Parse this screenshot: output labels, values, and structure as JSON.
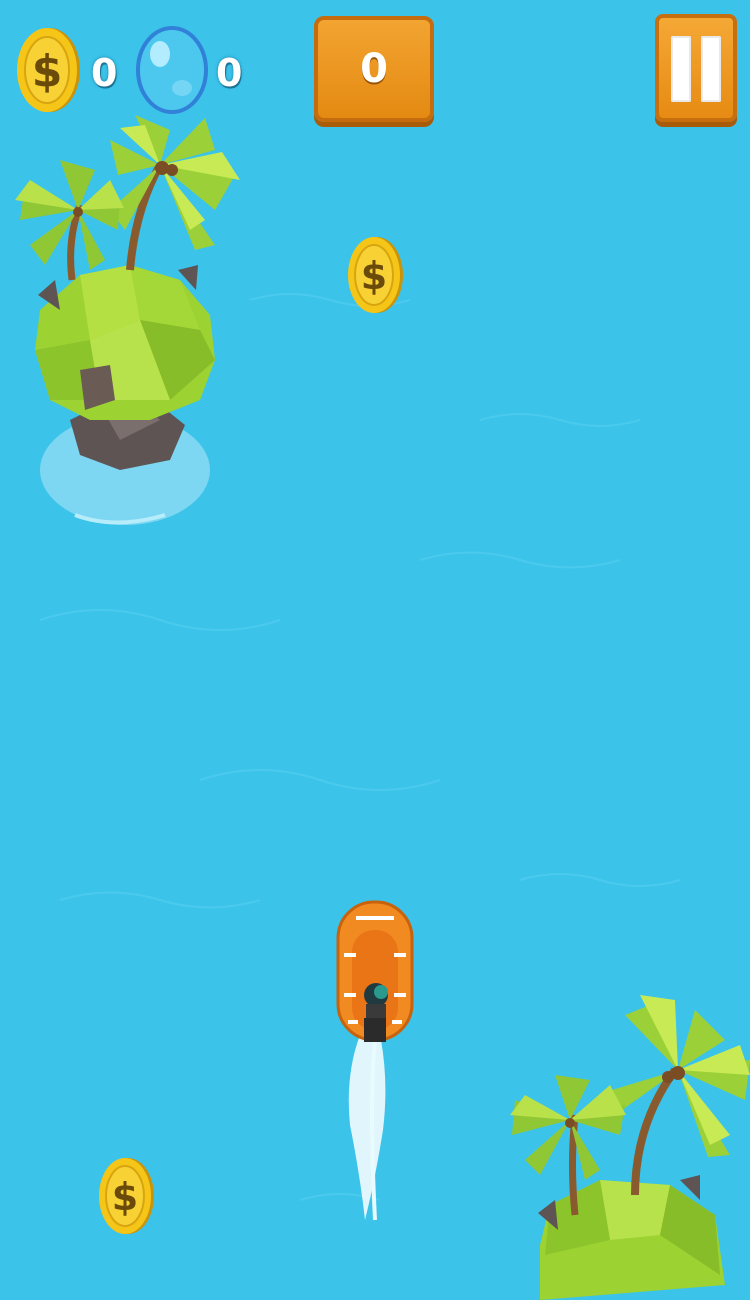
{
  "hud": {
    "coin_count": "0",
    "bubble_count": "0",
    "score": "0",
    "icons": {
      "coin": "coin-icon",
      "bubble": "bubble-shield-icon",
      "pause": "pause-icon"
    }
  },
  "colors": {
    "water": "#3bc3ea",
    "button_orange": "#ef9a25",
    "coin_gold": "#f5c518",
    "island_green": "#a7d93a",
    "boat_orange": "#f28a22"
  }
}
